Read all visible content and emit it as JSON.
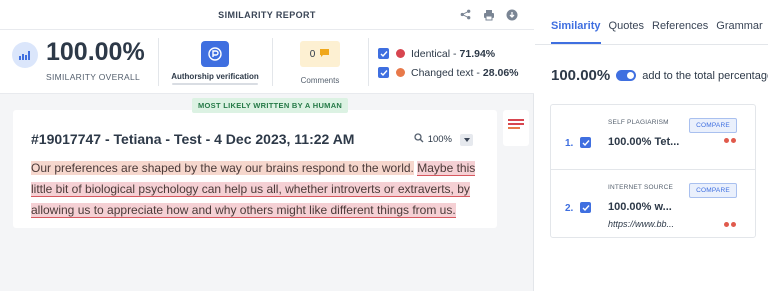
{
  "header": {
    "title": "SIMILARITY REPORT",
    "icons": [
      "share-icon",
      "print-icon",
      "download-icon"
    ]
  },
  "summary": {
    "similarity_value": "100.00%",
    "similarity_label": "SIMILARITY OVERALL",
    "authorship_label": "Authorship verification",
    "comments_count": "0",
    "comments_label": "Comments",
    "legend": [
      {
        "label": "Identical - ",
        "value": "71.94%",
        "color": "#d7454f"
      },
      {
        "label": "Changed text - ",
        "value": "28.06%",
        "color": "#e8794a"
      }
    ]
  },
  "badge": "MOST LIKELY WRITTEN BY A HUMAN",
  "document": {
    "title": "#19017747 - Tetiana - Test - 4 Dec 2023, 11:22 AM",
    "zoom": "100%",
    "segments": [
      {
        "text": "Our preferences are shaped by the way our brains respond to the world.",
        "match": "changed"
      },
      {
        "text": " ",
        "match": "none"
      },
      {
        "text": "Maybe this little bit of biological psychology can help us all, whether introverts or extraverts, by allowing us to appreciate how and why others might like different things from us.",
        "match": "identical"
      }
    ]
  },
  "sidebar": {
    "tabs": [
      "Similarity",
      "Quotes",
      "References",
      "Grammar"
    ],
    "active_tab": "Similarity",
    "total_pct": "100.00%",
    "total_label": "add to the total percentage",
    "sources": [
      {
        "num": "1.",
        "type": "SELF PLAGIARISM",
        "pct": "100.00%",
        "name": "Tet...",
        "url": "",
        "compare": "COMPARE"
      },
      {
        "num": "2.",
        "type": "INTERNET SOURCE",
        "pct": "100.00%",
        "name": "w...",
        "url": "https://www.bb...",
        "compare": "COMPARE"
      }
    ]
  },
  "colors": {
    "accent": "#3f6fe0",
    "identical": "#d7454f",
    "changed": "#e8794a",
    "human_badge": "#257a47"
  }
}
